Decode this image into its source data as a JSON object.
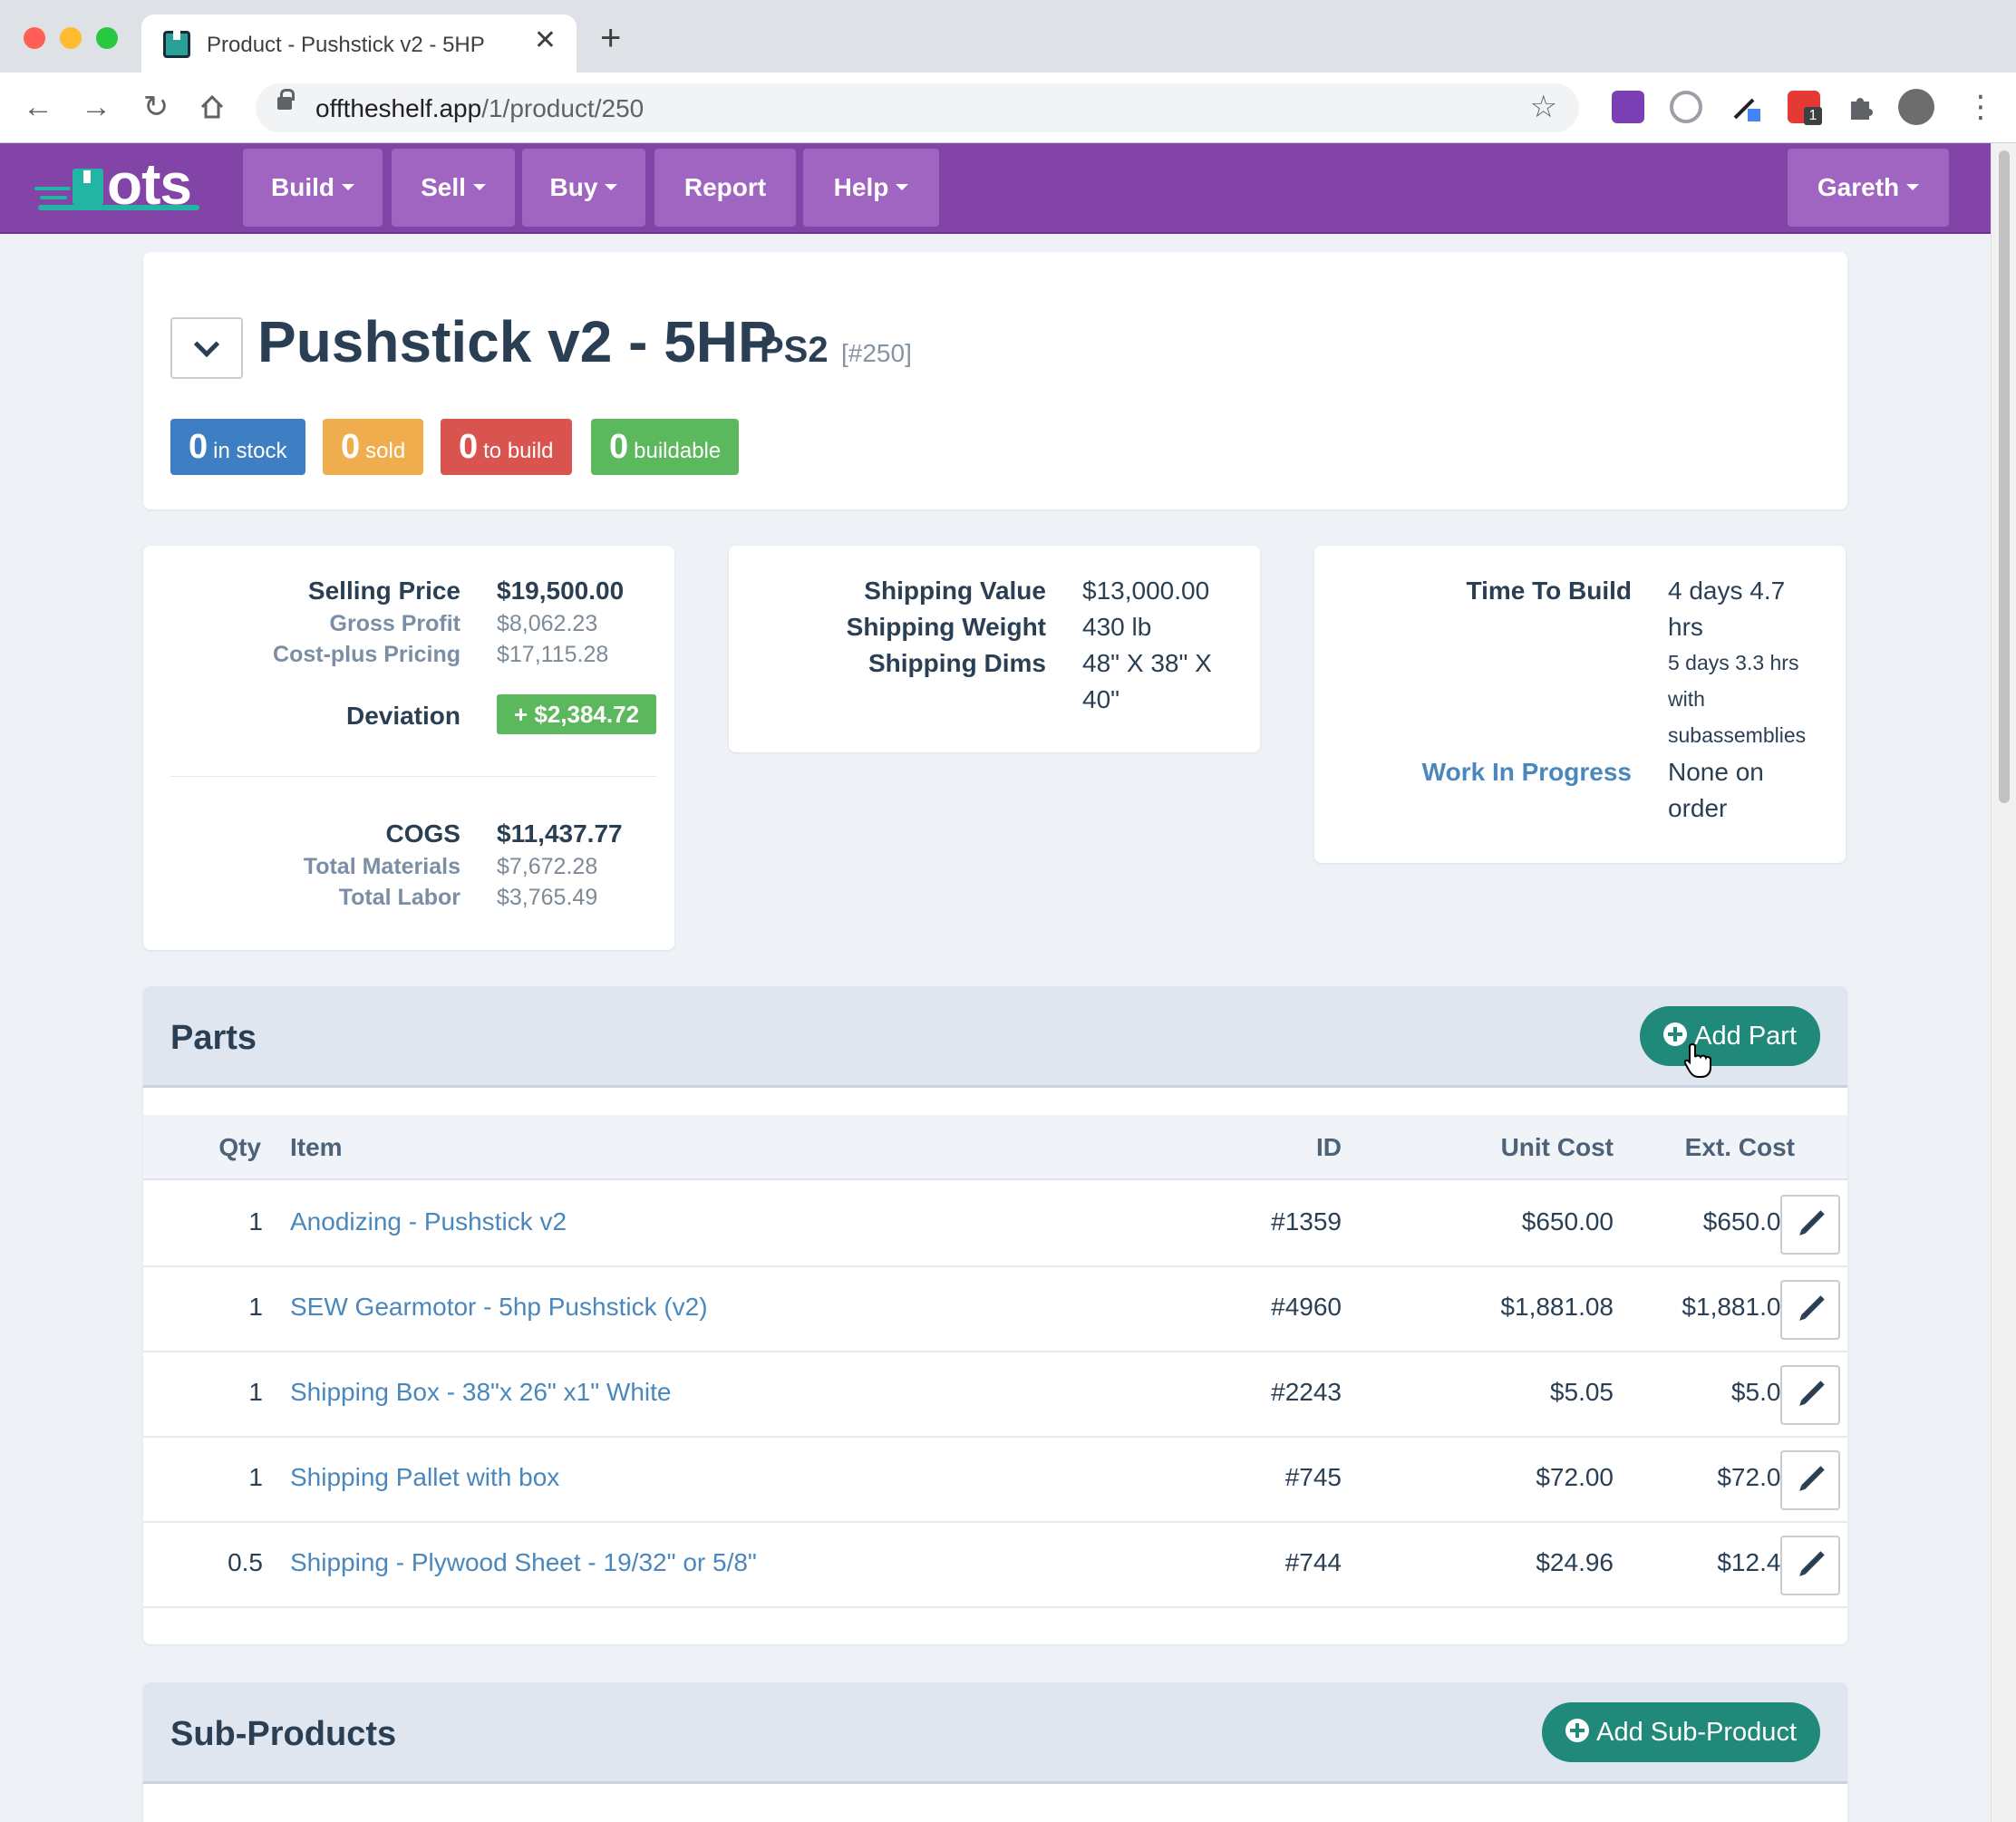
{
  "browser": {
    "tab_title": "Product - Pushstick v2 - 5HP",
    "tab_close": "✕",
    "new_tab": "+",
    "url_host": "offtheshelf.app",
    "url_path": "/1/product/250",
    "ext_badge": "1"
  },
  "app": {
    "logo": "ots",
    "nav": [
      "Build",
      "Sell",
      "Buy",
      "Report",
      "Help"
    ],
    "user": "Gareth"
  },
  "product": {
    "name": "Pushstick v2 - 5HP",
    "sku": "PS2",
    "id": "[#250]",
    "badges": [
      {
        "count": "0",
        "label": "in stock",
        "color": "#3d7fc2"
      },
      {
        "count": "0",
        "label": "sold",
        "color": "#f0ad4e"
      },
      {
        "count": "0",
        "label": "to build",
        "color": "#d9534f"
      },
      {
        "count": "0",
        "label": "buildable",
        "color": "#5cb85c"
      }
    ]
  },
  "pricing": {
    "selling_price_label": "Selling Price",
    "selling_price": "$19,500.00",
    "gross_profit_label": "Gross Profit",
    "gross_profit": "$8,062.23",
    "cost_plus_label": "Cost-plus Pricing",
    "cost_plus": "$17,115.28",
    "deviation_label": "Deviation",
    "deviation": "+ $2,384.72",
    "cogs_label": "COGS",
    "cogs": "$11,437.77",
    "materials_label": "Total Materials",
    "materials": "$7,672.28",
    "labor_label": "Total Labor",
    "labor": "$3,765.49"
  },
  "shipping": {
    "value_label": "Shipping Value",
    "value": "$13,000.00",
    "weight_label": "Shipping Weight",
    "weight": "430 lb",
    "dims_label": "Shipping Dims",
    "dims_line1": "48\" X 38\" X",
    "dims_line2": "40\""
  },
  "build": {
    "time_label": "Time To Build",
    "time_line1": "4 days 4.7",
    "time_line2": "hrs",
    "sub_line1": "5 days 3.3 hrs",
    "sub_line2": "with",
    "sub_line3": "subassemblies",
    "wip_label": "Work In Progress",
    "wip_line1": "None on",
    "wip_line2": "order"
  },
  "parts": {
    "title": "Parts",
    "add_label": "Add Part",
    "columns": {
      "qty": "Qty",
      "item": "Item",
      "id": "ID",
      "unit_cost": "Unit Cost",
      "ext_cost": "Ext. Cost"
    },
    "rows": [
      {
        "qty": "1",
        "item": "Anodizing - Pushstick v2",
        "id": "#1359",
        "unit_cost": "$650.00",
        "ext_cost": "$650.00"
      },
      {
        "qty": "1",
        "item": "SEW Gearmotor - 5hp Pushstick (v2)",
        "id": "#4960",
        "unit_cost": "$1,881.08",
        "ext_cost": "$1,881.08"
      },
      {
        "qty": "1",
        "item": "Shipping Box - 38\"x 26\" x1\" White",
        "id": "#2243",
        "unit_cost": "$5.05",
        "ext_cost": "$5.05"
      },
      {
        "qty": "1",
        "item": "Shipping Pallet with box",
        "id": "#745",
        "unit_cost": "$72.00",
        "ext_cost": "$72.00"
      },
      {
        "qty": "0.5",
        "item": "Shipping - Plywood Sheet - 19/32\" or 5/8\"",
        "id": "#744",
        "unit_cost": "$24.96",
        "ext_cost": "$12.48"
      }
    ]
  },
  "subproducts": {
    "title": "Sub-Products",
    "add_label": "Add Sub-Product"
  },
  "colors": {
    "nav_purple": "#8344a7",
    "nav_button": "#a065c0",
    "teal_button": "#20897a",
    "link_blue": "#4a87bd"
  }
}
